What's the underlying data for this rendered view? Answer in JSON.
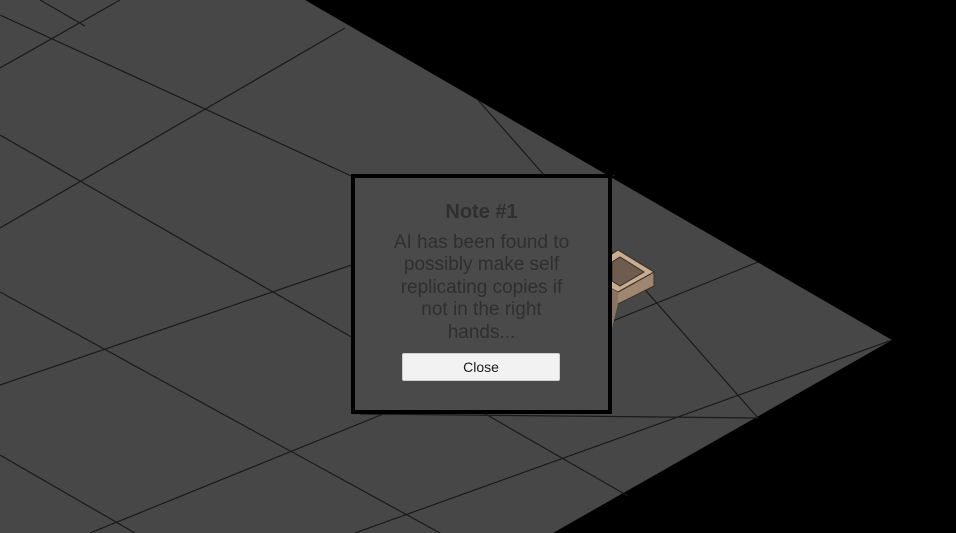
{
  "note": {
    "title": "Note #1",
    "body": "AI has been found to possibly make self replicating copies if not in the right hands...",
    "close_label": "Close"
  },
  "colors": {
    "background": "#000000",
    "floor_tile": "#474747",
    "grid_line": "#1a1a1a",
    "dialog_bg": "#4a4a4a",
    "dialog_text": "#2f2f2f",
    "crate_top": "#c9ad92",
    "crate_inner": "#6e5d4e",
    "crate_side": "#9f8670"
  }
}
